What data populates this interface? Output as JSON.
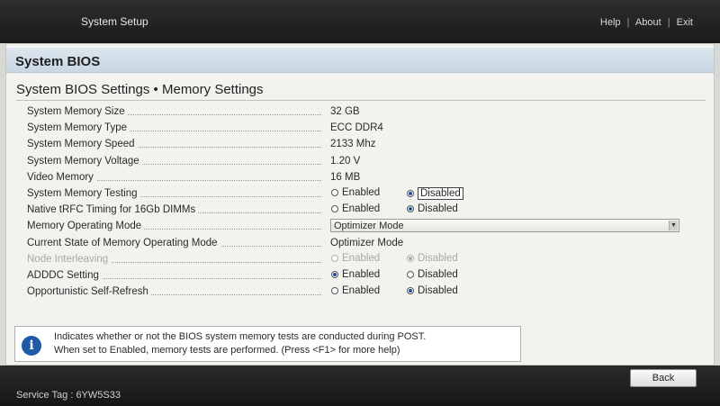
{
  "header": {
    "app_title": "System Setup",
    "help": "Help",
    "about": "About",
    "exit": "Exit",
    "separator": "|"
  },
  "section": {
    "title": "System BIOS"
  },
  "page": {
    "title": "System BIOS Settings • Memory Settings"
  },
  "settings": {
    "memory_size": {
      "label": "System Memory Size",
      "value": "32 GB"
    },
    "memory_type": {
      "label": "System Memory Type",
      "value": "ECC DDR4"
    },
    "memory_speed": {
      "label": "System Memory Speed",
      "value": "2133 Mhz"
    },
    "memory_voltage": {
      "label": "System Memory Voltage",
      "value": "1.20 V"
    },
    "video_memory": {
      "label": "Video Memory",
      "value": "16 MB"
    },
    "memory_testing": {
      "label": "System Memory Testing",
      "option1": "Enabled",
      "option2": "Disabled",
      "selected": "Disabled"
    },
    "native_trfc": {
      "label": "Native tRFC Timing for 16Gb DIMMs",
      "option1": "Enabled",
      "option2": "Disabled",
      "selected": "Disabled"
    },
    "operating_mode": {
      "label": "Memory Operating Mode",
      "value": "Optimizer Mode"
    },
    "current_state": {
      "label": "Current State of Memory Operating Mode",
      "value": "Optimizer Mode"
    },
    "node_interleaving": {
      "label": "Node Interleaving",
      "option1": "Enabled",
      "option2": "Disabled",
      "selected": "Disabled"
    },
    "adddc": {
      "label": "ADDDC Setting",
      "option1": "Enabled",
      "option2": "Disabled",
      "selected": "Enabled"
    },
    "self_refresh": {
      "label": "Opportunistic Self-Refresh",
      "option1": "Enabled",
      "option2": "Disabled",
      "selected": "Disabled"
    }
  },
  "help": {
    "line1": "Indicates whether or not the BIOS system memory tests are conducted during POST.",
    "line2": "When set to Enabled, memory tests are performed. (Press <F1> for more help)"
  },
  "footer": {
    "service_tag": "Service Tag : 6YW5S33",
    "back_label": "Back"
  },
  "colors": {
    "header_bg": "#1f1f1f",
    "section_band": "#c9d7e3",
    "radio_selected": "#1f4f9a",
    "info_icon": "#1f5aa8"
  }
}
